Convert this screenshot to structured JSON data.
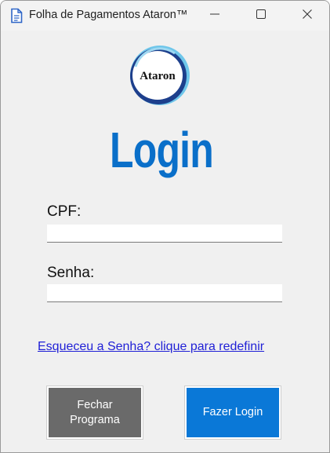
{
  "window": {
    "title": "Folha de Pagamentos Ataron™",
    "controls": [
      "minimize-icon",
      "maximize-icon",
      "close-icon"
    ]
  },
  "logo": {
    "text": "Ataron"
  },
  "heading": "Login",
  "form": {
    "cpf_label": "CPF:",
    "cpf_value": "",
    "senha_label": "Senha:",
    "senha_value": ""
  },
  "forgot_link": "Esqueceu a Senha? clique para redefinir",
  "buttons": {
    "close_label": "Fechar\nPrograma",
    "login_label": "Fazer Login"
  },
  "colors": {
    "accent": "#0a78d7",
    "heading": "#0a6fc9",
    "close_button": "#6a6a6a",
    "link": "#1f1fd6"
  }
}
